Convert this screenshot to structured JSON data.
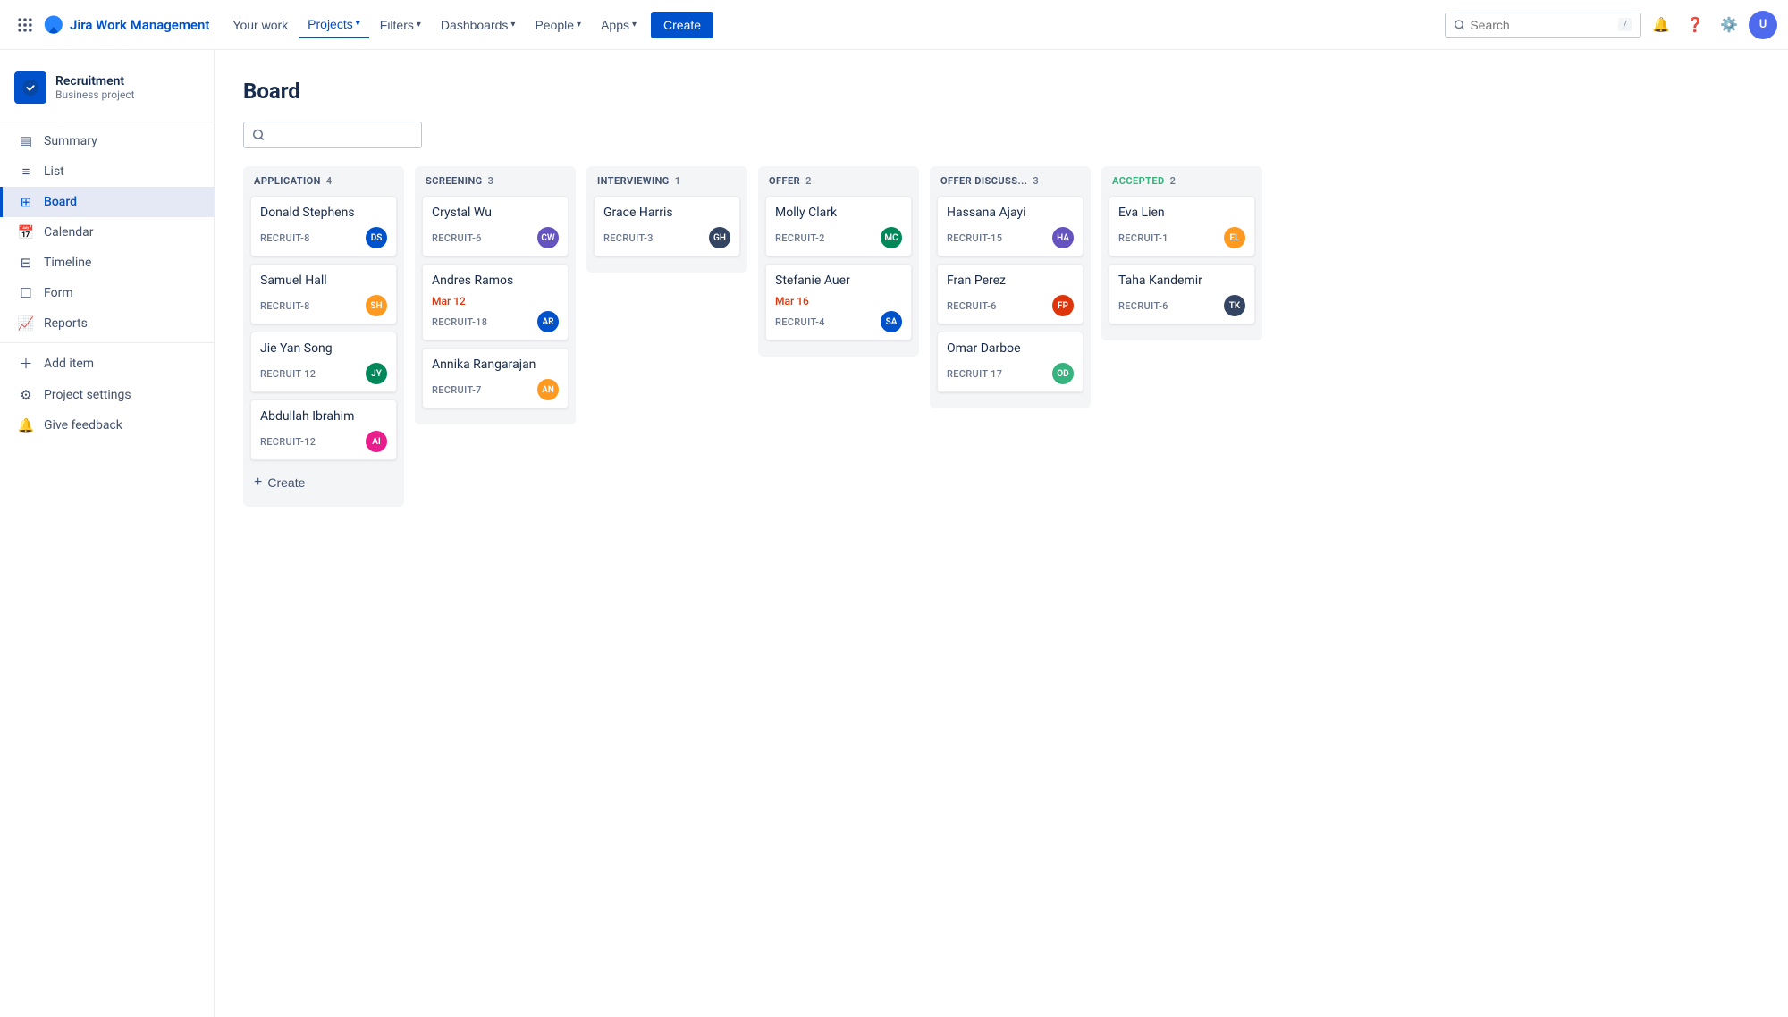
{
  "app": {
    "name": "Jira Work Management"
  },
  "topnav": {
    "your_work": "Your work",
    "projects": "Projects",
    "filters": "Filters",
    "dashboards": "Dashboards",
    "people": "People",
    "apps": "Apps",
    "create": "Create",
    "search_placeholder": "Search",
    "search_shortcut": "/"
  },
  "sidebar": {
    "project_name": "Recruitment",
    "project_type": "Business project",
    "items": [
      {
        "id": "summary",
        "label": "Summary",
        "icon": "▤"
      },
      {
        "id": "list",
        "label": "List",
        "icon": "≡"
      },
      {
        "id": "board",
        "label": "Board",
        "icon": "⊞",
        "active": true
      },
      {
        "id": "calendar",
        "label": "Calendar",
        "icon": "📅"
      },
      {
        "id": "timeline",
        "label": "Timeline",
        "icon": "⊟"
      },
      {
        "id": "form",
        "label": "Form",
        "icon": "☐"
      },
      {
        "id": "reports",
        "label": "Reports",
        "icon": "📈"
      },
      {
        "id": "add-item",
        "label": "Add item",
        "icon": "+"
      },
      {
        "id": "project-settings",
        "label": "Project settings",
        "icon": "⚙"
      },
      {
        "id": "give-feedback",
        "label": "Give feedback",
        "icon": "🔔"
      }
    ]
  },
  "board": {
    "title": "Board",
    "search_placeholder": "",
    "columns": [
      {
        "id": "application",
        "title": "APPLICATION",
        "count": 4,
        "accent": "#42526e",
        "cards": [
          {
            "id": "c1",
            "name": "Donald Stephens",
            "ticket": "RECRUIT-8",
            "due": null,
            "av_color": "av-blue",
            "av_initials": "DS"
          },
          {
            "id": "c2",
            "name": "Samuel Hall",
            "ticket": "RECRUIT-8",
            "due": null,
            "av_color": "av-orange",
            "av_initials": "SH"
          },
          {
            "id": "c3",
            "name": "Jie Yan Song",
            "ticket": "RECRUIT-12",
            "due": null,
            "av_color": "av-teal",
            "av_initials": "JY"
          },
          {
            "id": "c4",
            "name": "Abdullah Ibrahim",
            "ticket": "RECRUIT-12",
            "due": null,
            "av_color": "av-pink",
            "av_initials": "AI"
          }
        ],
        "create": true
      },
      {
        "id": "screening",
        "title": "SCREENING",
        "count": 3,
        "accent": "#42526e",
        "cards": [
          {
            "id": "c5",
            "name": "Crystal Wu",
            "ticket": "RECRUIT-6",
            "due": null,
            "av_color": "av-purple",
            "av_initials": "CW"
          },
          {
            "id": "c6",
            "name": "Andres Ramos",
            "ticket": "RECRUIT-18",
            "due": "Mar 12",
            "av_color": "av-blue",
            "av_initials": "AR"
          },
          {
            "id": "c7",
            "name": "Annika Rangarajan",
            "ticket": "RECRUIT-7",
            "due": null,
            "av_color": "av-orange",
            "av_initials": "AN"
          }
        ],
        "create": false
      },
      {
        "id": "interviewing",
        "title": "INTERVIEWING",
        "count": 1,
        "accent": "#42526e",
        "cards": [
          {
            "id": "c8",
            "name": "Grace Harris",
            "ticket": "RECRUIT-3",
            "due": null,
            "av_color": "av-dark",
            "av_initials": "GH"
          }
        ],
        "create": false
      },
      {
        "id": "offer",
        "title": "OFFER",
        "count": 2,
        "accent": "#42526e",
        "cards": [
          {
            "id": "c9",
            "name": "Molly Clark",
            "ticket": "RECRUIT-2",
            "due": null,
            "av_color": "av-teal",
            "av_initials": "MC"
          },
          {
            "id": "c10",
            "name": "Stefanie Auer",
            "ticket": "RECRUIT-4",
            "due": "Mar 16",
            "av_color": "av-blue",
            "av_initials": "SA"
          }
        ],
        "create": false
      },
      {
        "id": "offer-discuss",
        "title": "OFFER DISCUSS...",
        "count": 3,
        "accent": "#42526e",
        "cards": [
          {
            "id": "c11",
            "name": "Hassana Ajayi",
            "ticket": "RECRUIT-15",
            "due": null,
            "av_color": "av-purple",
            "av_initials": "HA"
          },
          {
            "id": "c12",
            "name": "Fran Perez",
            "ticket": "RECRUIT-6",
            "due": null,
            "av_color": "av-red",
            "av_initials": "FP"
          },
          {
            "id": "c13",
            "name": "Omar Darboe",
            "ticket": "RECRUIT-17",
            "due": null,
            "av_color": "av-green",
            "av_initials": "OD"
          }
        ],
        "create": false
      },
      {
        "id": "accepted",
        "title": "ACCEPTED",
        "count": 2,
        "accent": "#36b37e",
        "cards": [
          {
            "id": "c14",
            "name": "Eva Lien",
            "ticket": "RECRUIT-1",
            "due": null,
            "av_color": "av-orange",
            "av_initials": "EL"
          },
          {
            "id": "c15",
            "name": "Taha Kandemir",
            "ticket": "RECRUIT-6",
            "due": null,
            "av_color": "av-dark",
            "av_initials": "TK"
          }
        ],
        "create": false
      }
    ],
    "create_label": "Create"
  }
}
